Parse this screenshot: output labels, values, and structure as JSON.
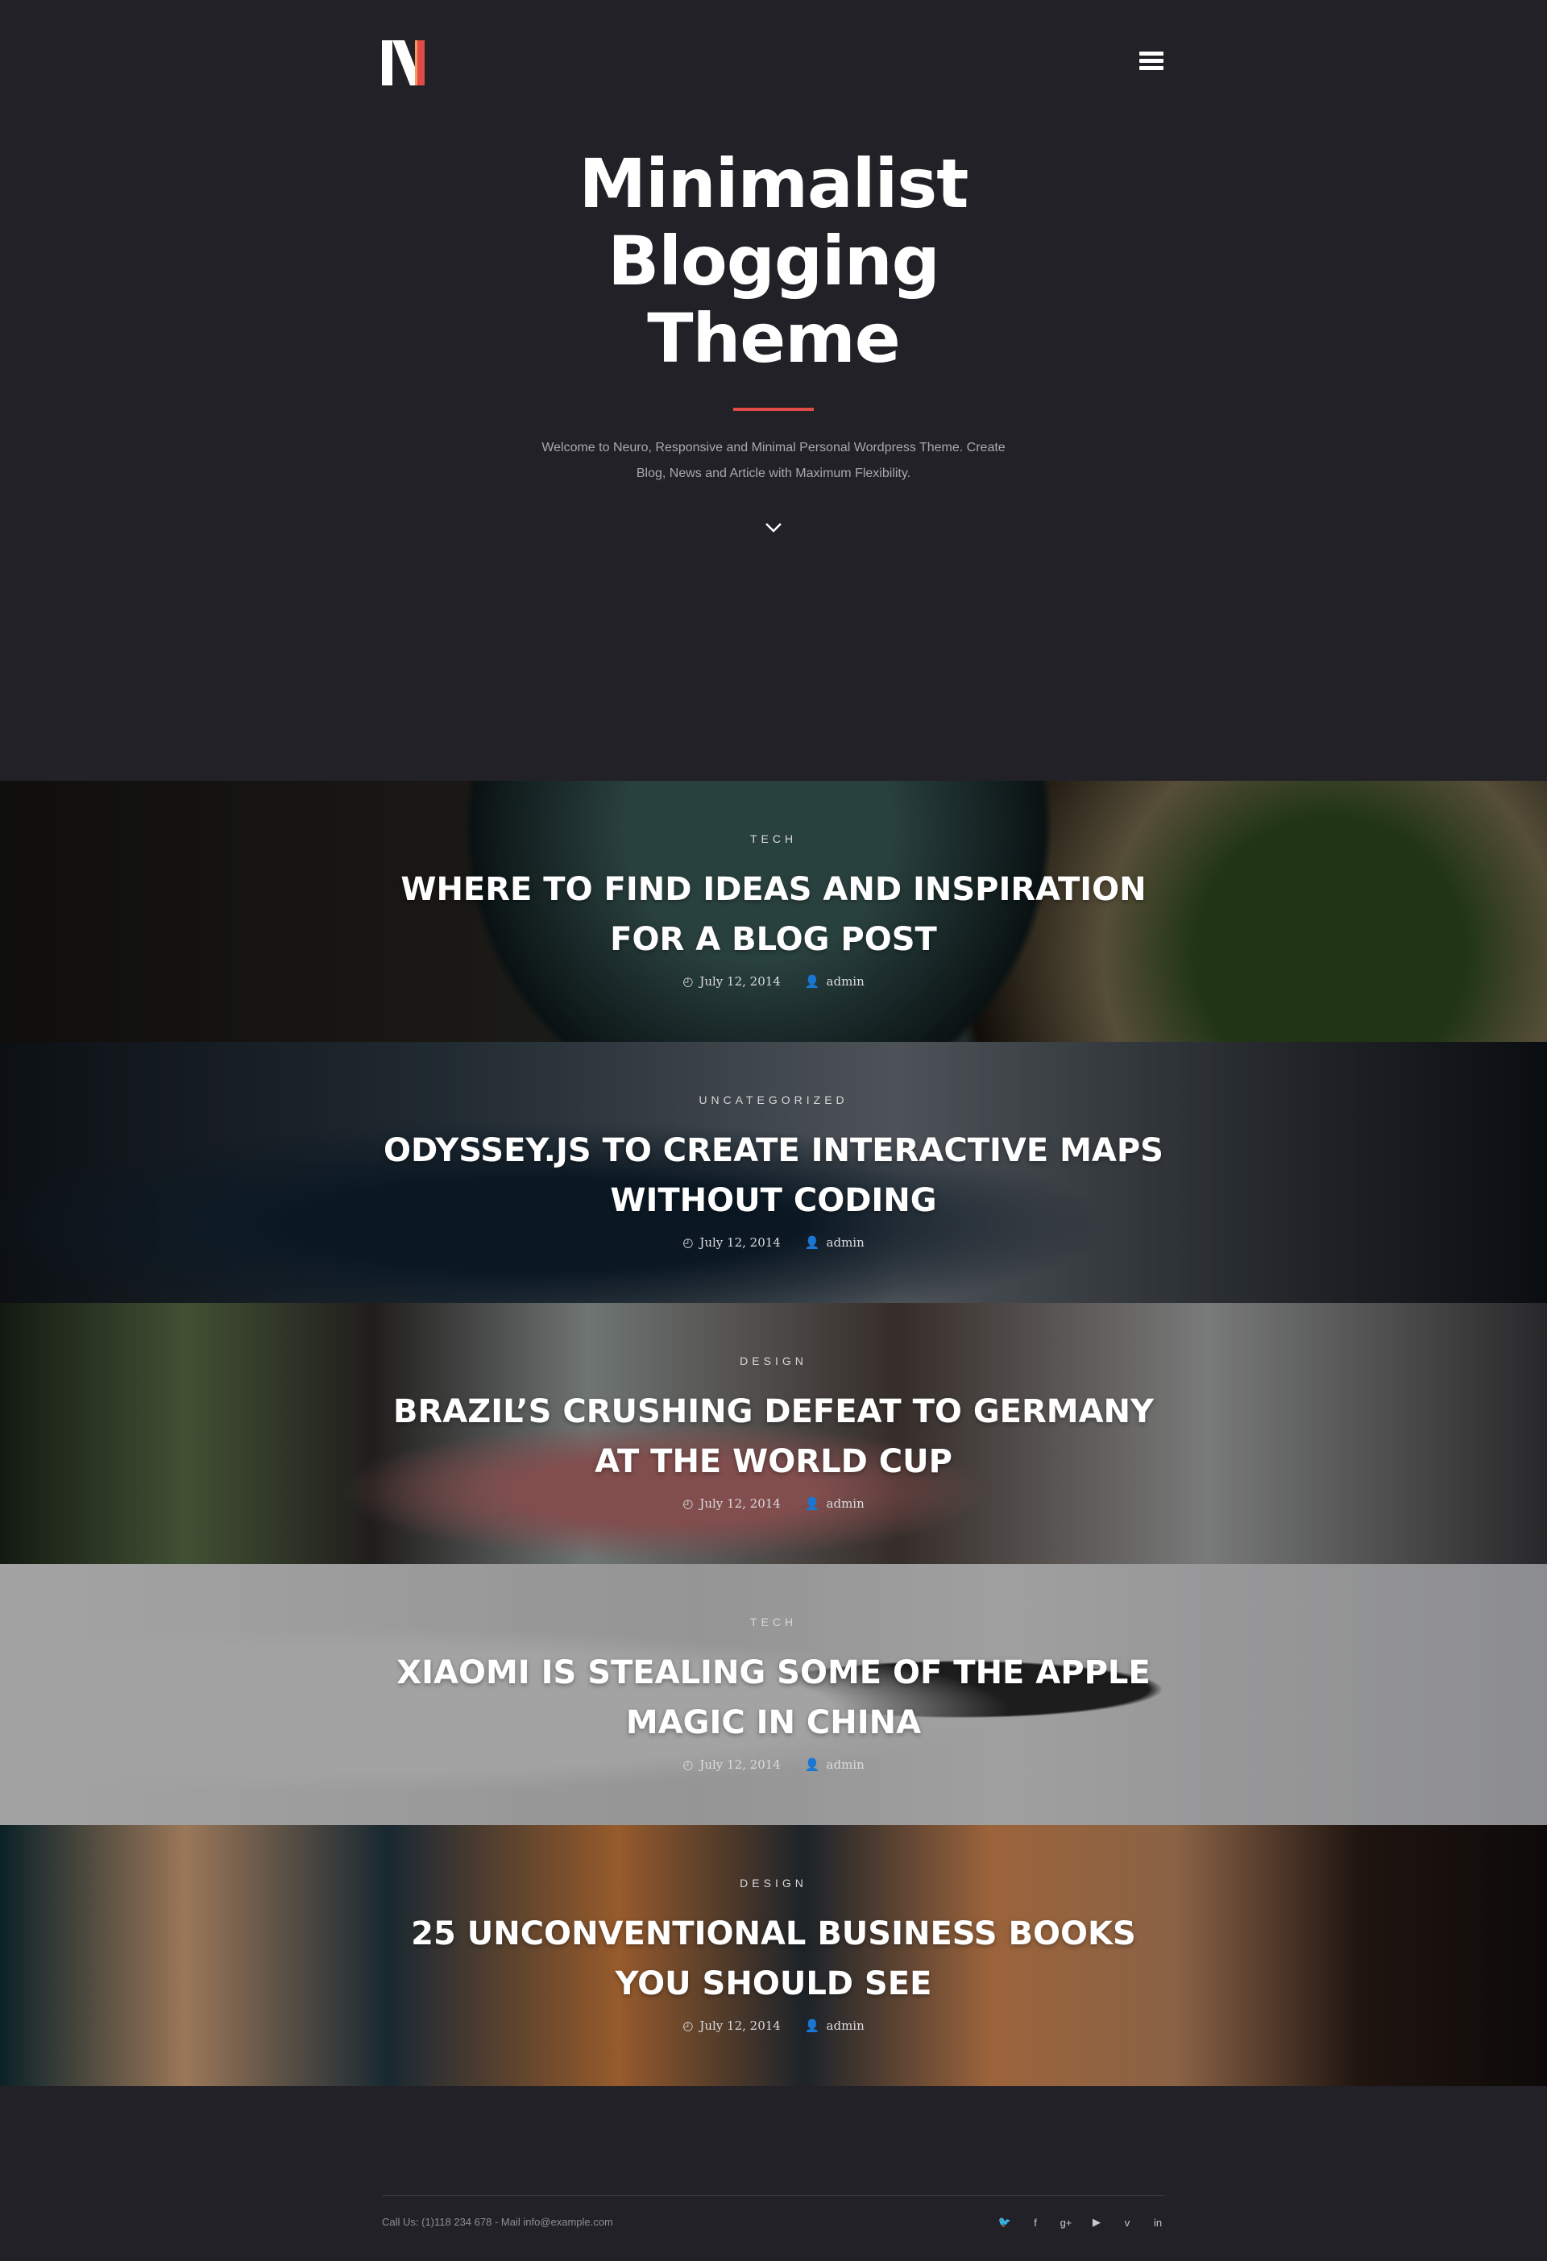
{
  "brand": {
    "logo_letter": "N",
    "accent_color": "#e14a47"
  },
  "header": {
    "menu_icon": "hamburger-menu-icon"
  },
  "hero": {
    "title_line1": "Minimalist",
    "title_line2": "Blogging",
    "title_line3": "Theme",
    "description": "Welcome to Neuro, Responsive and Minimal Personal Wordpress Theme. Create Blog, News and Article with Maximum Flexibility.",
    "scroll_icon": "chevron-down-icon"
  },
  "posts": [
    {
      "category": "TECH",
      "title": "WHERE TO FIND IDEAS AND INSPIRATION FOR A BLOG POST",
      "date": "July 12, 2014",
      "author": "admin"
    },
    {
      "category": "UNCATEGORIZED",
      "title": "ODYSSEY.JS TO CREATE INTERACTIVE MAPS WITHOUT CODING",
      "date": "July 12, 2014",
      "author": "admin"
    },
    {
      "category": "DESIGN",
      "title": "BRAZIL’S CRUSHING DEFEAT TO GERMANY AT THE WORLD CUP",
      "date": "July 12, 2014",
      "author": "admin"
    },
    {
      "category": "TECH",
      "title": "XIAOMI IS STEALING SOME OF THE APPLE MAGIC IN CHINA",
      "date": "July 12, 2014",
      "author": "admin"
    },
    {
      "category": "DESIGN",
      "title": "25 UNCONVENTIONAL BUSINESS BOOKS YOU SHOULD SEE",
      "date": "July 12, 2014",
      "author": "admin"
    }
  ],
  "footer": {
    "contact": "Call Us: (1)118 234 678 - Mail info@example.com",
    "social": {
      "twitter": "🐦",
      "facebook": "f",
      "googleplus": "g+",
      "youtube": "▶",
      "vimeo": "v",
      "linkedin": "in"
    }
  }
}
